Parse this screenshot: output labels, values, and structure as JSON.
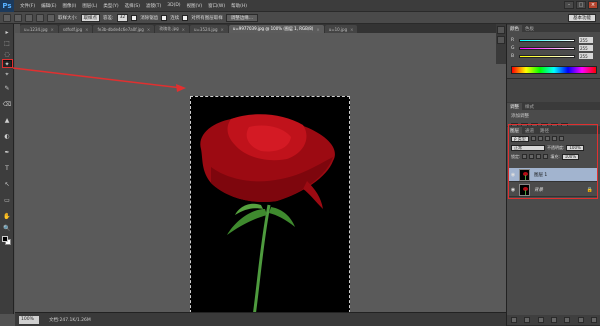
{
  "app": {
    "logo": "Ps"
  },
  "menu": [
    "文件(F)",
    "编辑(E)",
    "图像(I)",
    "图层(L)",
    "类型(Y)",
    "选择(S)",
    "滤镜(T)",
    "3D(D)",
    "视图(V)",
    "窗口(W)",
    "帮助(H)"
  ],
  "window_controls": {
    "minimize": "–",
    "maximize": "□",
    "close": "×"
  },
  "options": {
    "sample_size_label": "取样大小:",
    "sample_size_value": "取样点",
    "tolerance_label": "容差:",
    "tolerance_value": "32",
    "antialias_label": "消除锯齿",
    "contiguous_label": "连续",
    "sample_all_label": "对所有图层取样",
    "refine_edge_label": "调整边缘...",
    "workspace": "基本功能"
  },
  "tabs": [
    {
      "label": "u=1234.jpg",
      "active": false
    },
    {
      "label": "sdfsdf.jpg",
      "active": false
    },
    {
      "label": "fe3b-dbde4c6e7a0f.jpg",
      "active": false
    },
    {
      "label": "玫瑰花.jpg",
      "active": false
    },
    {
      "label": "u=3524.jpg",
      "active": false
    },
    {
      "label": "u=9977039.jpg @ 100% (图层 1, RGB/8)",
      "active": true
    },
    {
      "label": "u=10.jpg",
      "active": false
    }
  ],
  "tools": [
    "▸",
    "⬚",
    "◌",
    "✦",
    "⌖",
    "✎",
    "⌫",
    "▲",
    "◐",
    "✒",
    "T",
    "↖",
    "▭",
    "✋",
    "🔍"
  ],
  "status": {
    "zoom": "100%",
    "doc_info": "文档:247.1K/1.26M"
  },
  "color_panel": {
    "tabs": [
      "颜色",
      "色板"
    ],
    "sliders": [
      {
        "letter": "R",
        "value": "255",
        "color": "#e6e6e6"
      },
      {
        "letter": "G",
        "value": "255",
        "color": "#e6e6e6"
      },
      {
        "letter": "B",
        "value": "255",
        "color": "#e6e6e6"
      }
    ]
  },
  "adjust_panel": {
    "tabs": [
      "调整",
      "样式"
    ],
    "title": "添加调整"
  },
  "layers_panel": {
    "tabs": [
      "图层",
      "通道",
      "路径"
    ],
    "kind_filter": "ρ 类型",
    "blend_mode": "正常",
    "opacity_label": "不透明度:",
    "opacity_value": "100%",
    "lock_label": "锁定:",
    "fill_label": "填充:",
    "fill_value": "100%",
    "layers": [
      {
        "name": "图层 1",
        "active": true
      },
      {
        "name": "背景",
        "active": false
      }
    ]
  },
  "colors": {
    "annotation": "#e03030",
    "rose": "#b50c14",
    "stem": "#4e9b3e"
  }
}
